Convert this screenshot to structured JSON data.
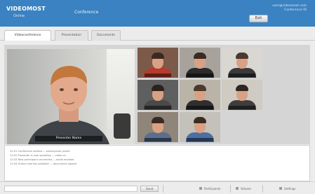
{
  "header": {
    "logo_main": "VIDEOMOST",
    "logo_sub": "Online",
    "conference_title": "Conference",
    "user_line": "user@videomost.com",
    "user_line2": "Conference ID",
    "exit_label": "Exit",
    "bar_color": "#3a82c1"
  },
  "tabs": [
    {
      "label": "Videoconference",
      "active": true
    },
    {
      "label": "Presentation",
      "active": false
    },
    {
      "label": "Documents",
      "active": false
    }
  ],
  "main_video": {
    "speaker_label": "Presenter Name"
  },
  "thumbnails": [
    {
      "bg": "#7c5a4a",
      "hair": "#3a2a22",
      "body": "#b63a2e"
    },
    {
      "bg": "#a7a39c",
      "hair": "#3b2a22",
      "body": "#2b2b2b"
    },
    {
      "bg": "#d9d7d2",
      "hair": "#4a3a30",
      "body": "#3a3a3a"
    },
    {
      "bg": "#5f5f5f",
      "hair": "#2c221c",
      "body": "#4a4a4a"
    },
    {
      "bg": "#b9b3a8",
      "hair": "#4b3a2c",
      "body": "#2f2f2f"
    },
    {
      "bg": "#cfcac2",
      "hair": "#2e2620",
      "body": "#3e3e3e"
    },
    {
      "bg": "#8f8578",
      "hair": "#3a2a22",
      "body": "#5a6f8f"
    },
    {
      "bg": "#c4c1bb",
      "hair": "#3b2c22",
      "body": "#4d6fa3"
    }
  ],
  "chat": {
    "lines": [
      "12:01  Conference started  —  participants joined",
      "12:02  Presenter is now speaking  —  video on",
      "12:03  New participant connected  —  audio enabled",
      "12:04  Screen sharing available  —  documents loaded"
    ]
  },
  "statusbar": {
    "send_label": "Send",
    "items": [
      "Participants",
      "Volume",
      "Settings"
    ]
  }
}
